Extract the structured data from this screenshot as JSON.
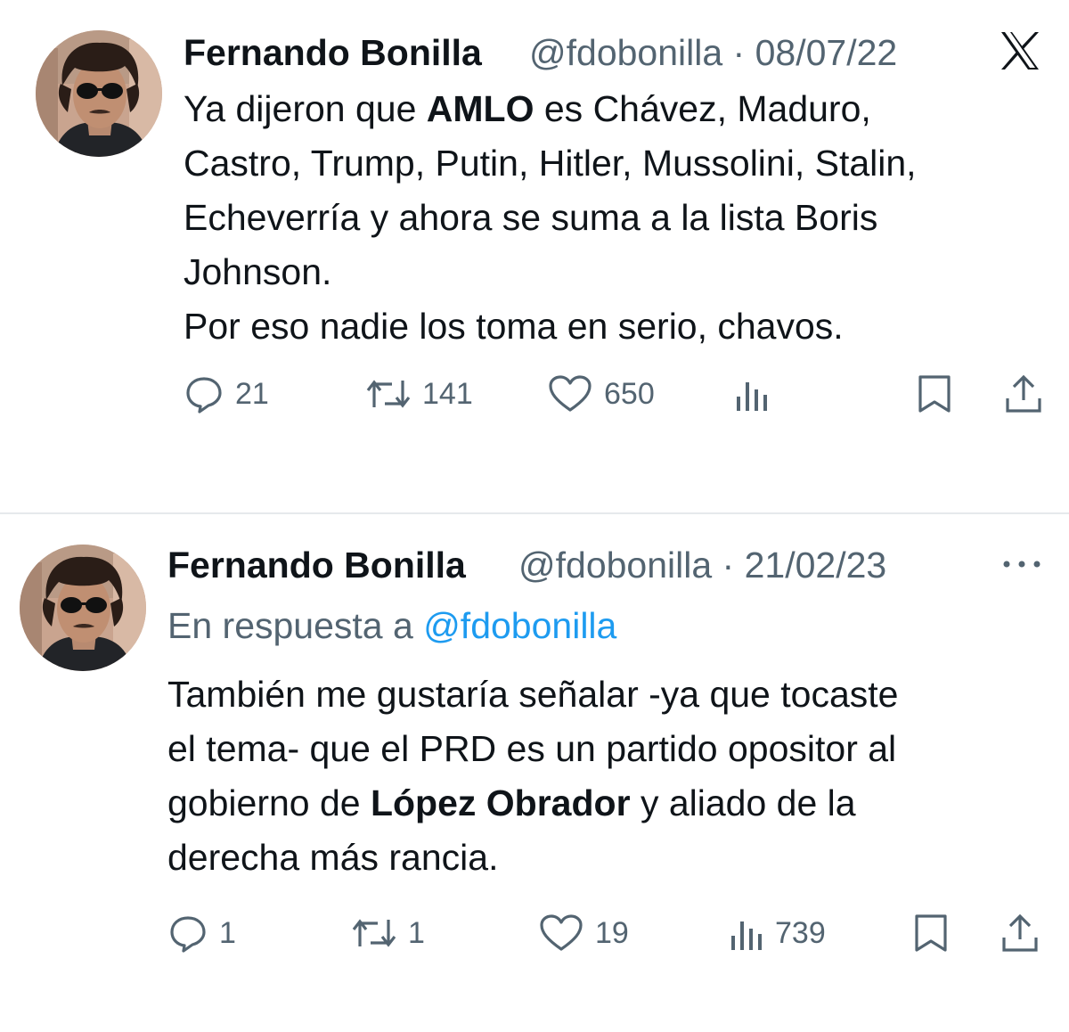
{
  "tweets": [
    {
      "author_name": "Fernando Bonilla",
      "handle_date": "@fdobonilla · 08/07/22",
      "lines": [
        {
          "pre": "Ya dijeron que ",
          "bold": "AMLO",
          "post": " es Chávez,  Maduro,"
        },
        {
          "pre": "Castro, Trump, Putin, Hitler, Mussolini, Stalin,",
          "bold": "",
          "post": ""
        },
        {
          "pre": "Echeverría y ahora se suma a la lista Boris",
          "bold": "",
          "post": ""
        },
        {
          "pre": "Johnson.",
          "bold": "",
          "post": ""
        },
        {
          "pre": "Por eso nadie los toma en serio, chavos.",
          "bold": "",
          "post": ""
        }
      ],
      "actions": {
        "replies": "21",
        "retweets": "141",
        "likes": "650",
        "views": ""
      },
      "corner_icon": "x-logo-icon"
    },
    {
      "author_name": "Fernando Bonilla",
      "handle_date": "@fdobonilla · 21/02/23",
      "reply_prefix": "En respuesta a ",
      "reply_mention": "@fdobonilla",
      "lines": [
        {
          "pre": "También me gustaría señalar -ya que tocaste",
          "bold": "",
          "post": ""
        },
        {
          "pre": "el tema- que el PRD es un partido opositor al",
          "bold": "",
          "post": ""
        },
        {
          "pre": "gobierno de ",
          "bold": "López Obrador",
          "post": " y aliado de la"
        },
        {
          "pre": "derecha más rancia.",
          "bold": "",
          "post": ""
        }
      ],
      "actions": {
        "replies": "1",
        "retweets": "1",
        "likes": "19",
        "views": "739"
      },
      "corner_icon": "more-options-icon"
    }
  ],
  "colors": {
    "text": "#0f1419",
    "secondary": "#536471",
    "link": "#1d9bf0",
    "divider": "#e6e9ec"
  }
}
